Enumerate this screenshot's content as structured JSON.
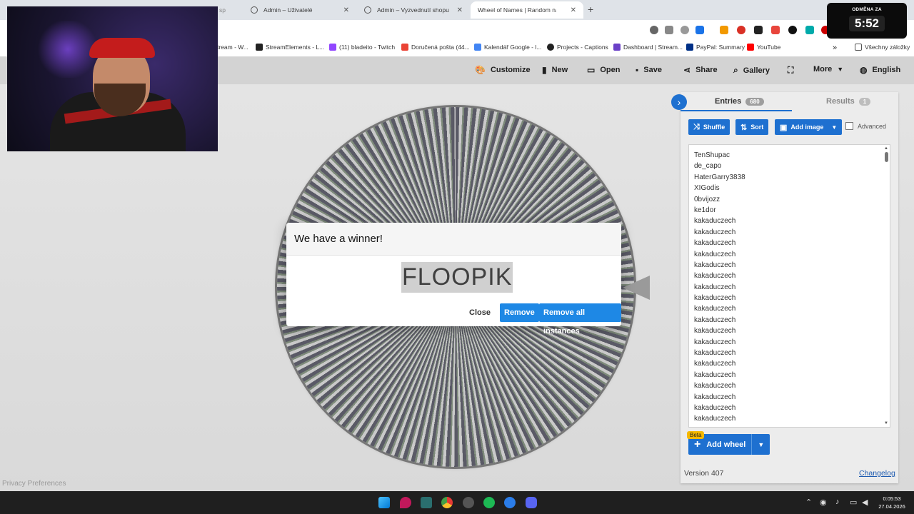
{
  "browser": {
    "tabs": [
      {
        "title": "Admin – Uživatelé"
      },
      {
        "title": "Admin – Vyzvednutí shopu"
      },
      {
        "title": "Wheel of Names | Random nam"
      }
    ],
    "tab_partial": "sp",
    "new_tab": "+"
  },
  "bookmarks": {
    "items": [
      {
        "label": "tream - W...",
        "color": "#6441a5"
      },
      {
        "label": "StreamElements - L...",
        "color": "#222222"
      },
      {
        "label": "(11) bladeito - Twitch",
        "color": "#9146ff"
      },
      {
        "label": "Doručená pošta (44...",
        "color": "#ea4335"
      },
      {
        "label": "Kalendář Google - l...",
        "color": "#4285f4"
      },
      {
        "label": "Projects - Captions",
        "color": "#222222"
      },
      {
        "label": "Dashboard | Stream...",
        "color": "#6a40c7"
      },
      {
        "label": "PayPal: Summary",
        "color": "#003087"
      },
      {
        "label": "YouTube",
        "color": "#ff0000"
      }
    ],
    "more": "»",
    "all_bookmarks": "Všechny záložky"
  },
  "timer": {
    "label": "ODMĚNA ZA",
    "value": "5:52"
  },
  "header": {
    "customize": "Customize",
    "new": "New",
    "open": "Open",
    "save": "Save",
    "share": "Share",
    "gallery": "Gallery",
    "more": "More",
    "language": "English"
  },
  "dialog": {
    "title": "We have a winner!",
    "winner": "FLOOPIK",
    "close": "Close",
    "remove": "Remove",
    "remove_all": "Remove all instances"
  },
  "panel": {
    "entries_label": "Entries",
    "entries_count": "680",
    "results_label": "Results",
    "results_count": "1",
    "shuffle": "Shuffle",
    "sort": "Sort",
    "add_image": "Add image",
    "advanced": "Advanced",
    "entries": [
      "TenShupac",
      "de_capo",
      "HaterGarry3838",
      "XIGodis",
      "0bvijozz",
      "ke1dor",
      "kakaduczech",
      "kakaduczech",
      "kakaduczech",
      "kakaduczech",
      "kakaduczech",
      "kakaduczech",
      "kakaduczech",
      "kakaduczech",
      "kakaduczech",
      "kakaduczech",
      "kakaduczech",
      "kakaduczech",
      "kakaduczech",
      "kakaduczech",
      "kakaduczech",
      "kakaduczech",
      "kakaduczech",
      "kakaduczech",
      "kakaduczech"
    ],
    "beta": "Beta",
    "add_wheel": "Add wheel",
    "version": "Version 407",
    "changelog": "Changelog"
  },
  "footer": {
    "privacy": "Privacy Preferences"
  },
  "taskbar": {
    "time": "0:05:53",
    "date": "27.04.2026"
  }
}
